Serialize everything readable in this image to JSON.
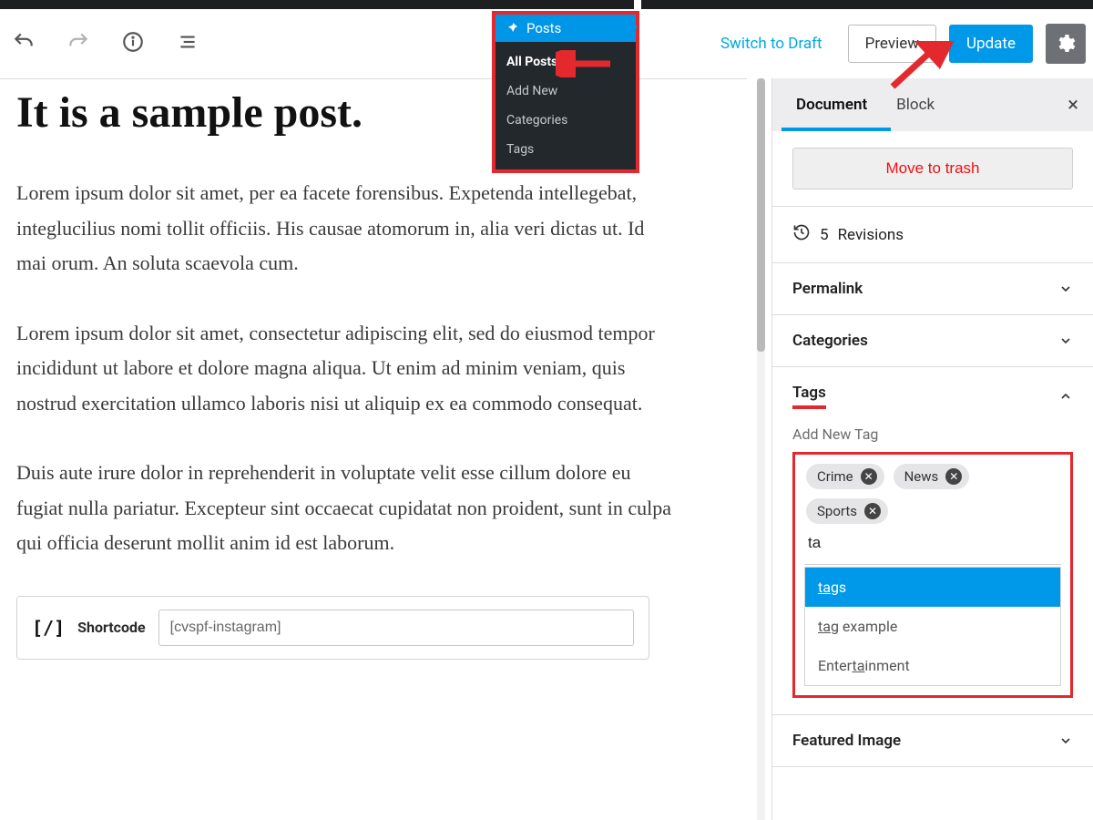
{
  "admin_menu": {
    "label": "Posts",
    "items": [
      "All Posts",
      "Add New",
      "Categories",
      "Tags"
    ]
  },
  "action_bar": {
    "switch_to_draft": "Switch to Draft",
    "preview": "Preview",
    "update": "Update"
  },
  "post": {
    "title": "It is a sample post.",
    "paragraphs": [
      "Lorem ipsum dolor sit amet, per ea facete forensibus. Expetenda intellegebat, integlucilius nomi tollit officiis. His causae atomorum in, alia veri dictas ut. Id mai orum. An soluta scaevola cum.",
      " Lorem ipsum dolor sit amet, consectetur adipiscing elit, sed do eiusmod tempor incididunt ut labore et dolore magna aliqua. Ut enim ad minim veniam, quis nostrud exercitation ullamco laboris nisi ut aliquip ex ea commodo consequat.",
      "Duis aute irure dolor in reprehenderit in voluptate velit esse cillum dolore eu fugiat nulla pariatur. Excepteur sint occaecat cupidatat non proident, sunt in culpa qui officia deserunt mollit anim id est laborum."
    ],
    "shortcode": {
      "label": "Shortcode",
      "value": "[cvspf-instagram]"
    }
  },
  "sidebar": {
    "tabs": {
      "document": "Document",
      "block": "Block"
    },
    "move_to_trash": "Move to trash",
    "revisions": {
      "count": "5",
      "label": "Revisions"
    },
    "panels": {
      "permalink": "Permalink",
      "categories": "Categories",
      "tags": "Tags",
      "featured_image": "Featured Image"
    },
    "tags": {
      "add_label": "Add New Tag",
      "chips": [
        "Crime",
        "News",
        "Sports"
      ],
      "input_value": "ta",
      "suggestions": [
        {
          "pre": "",
          "match": "ta",
          "post": "gs",
          "selected": true
        },
        {
          "pre": "",
          "match": "ta",
          "post": "g example",
          "selected": false
        },
        {
          "pre": "Enter",
          "match": "ta",
          "post": "inment",
          "selected": false
        }
      ]
    }
  }
}
